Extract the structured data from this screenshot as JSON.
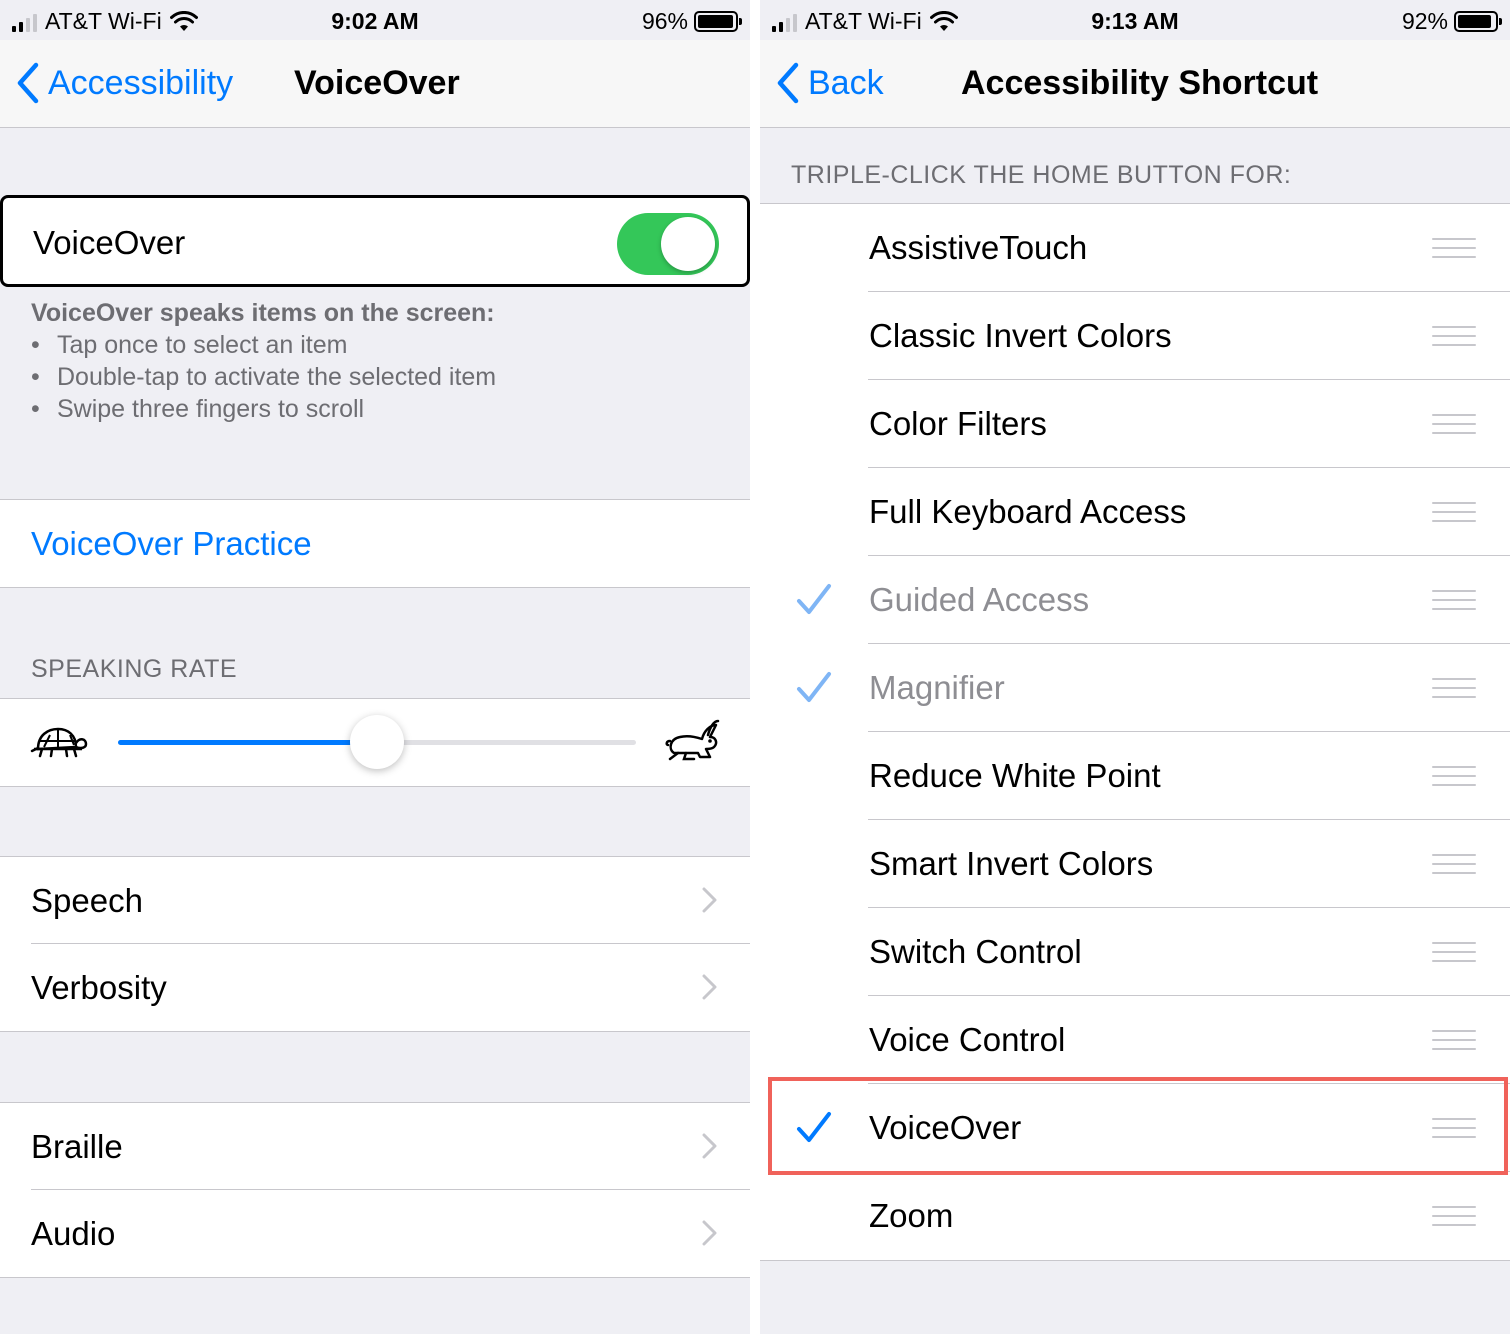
{
  "left": {
    "status": {
      "carrier": "AT&T Wi-Fi",
      "time": "9:02 AM",
      "battery": "96%",
      "battery_level": 0.96
    },
    "nav": {
      "back_label": "Accessibility",
      "title": "VoiceOver"
    },
    "voiceover_toggle": {
      "label": "VoiceOver",
      "on": true,
      "color": "#34c759"
    },
    "description": {
      "heading": "VoiceOver speaks items on the screen:",
      "items": [
        "Tap once to select an item",
        "Double-tap to activate the selected item",
        "Swipe three fingers to scroll"
      ]
    },
    "practice_label": "VoiceOver Practice",
    "speaking_rate": {
      "header": "SPEAKING RATE",
      "value": 0.5
    },
    "group1": [
      "Speech",
      "Verbosity"
    ],
    "group2": [
      "Braille",
      "Audio"
    ]
  },
  "right": {
    "status": {
      "carrier": "AT&T Wi-Fi",
      "time": "9:13 AM",
      "battery": "92%",
      "battery_level": 0.92
    },
    "nav": {
      "back_label": "Back",
      "title": "Accessibility Shortcut"
    },
    "section_header": "TRIPLE-CLICK THE HOME BUTTON FOR:",
    "items": [
      {
        "label": "AssistiveTouch",
        "checked": false,
        "disabled": false
      },
      {
        "label": "Classic Invert Colors",
        "checked": false,
        "disabled": false
      },
      {
        "label": "Color Filters",
        "checked": false,
        "disabled": false
      },
      {
        "label": "Full Keyboard Access",
        "checked": false,
        "disabled": false
      },
      {
        "label": "Guided Access",
        "checked": true,
        "disabled": true
      },
      {
        "label": "Magnifier",
        "checked": true,
        "disabled": true
      },
      {
        "label": "Reduce White Point",
        "checked": false,
        "disabled": false
      },
      {
        "label": "Smart Invert Colors",
        "checked": false,
        "disabled": false
      },
      {
        "label": "Switch Control",
        "checked": false,
        "disabled": false
      },
      {
        "label": "Voice Control",
        "checked": false,
        "disabled": false
      },
      {
        "label": "VoiceOver",
        "checked": true,
        "disabled": false,
        "highlighted": true
      },
      {
        "label": "Zoom",
        "checked": false,
        "disabled": false
      }
    ],
    "highlight_color": "#f0625a"
  },
  "colors": {
    "accent": "#007aff",
    "background": "#efeff4"
  }
}
